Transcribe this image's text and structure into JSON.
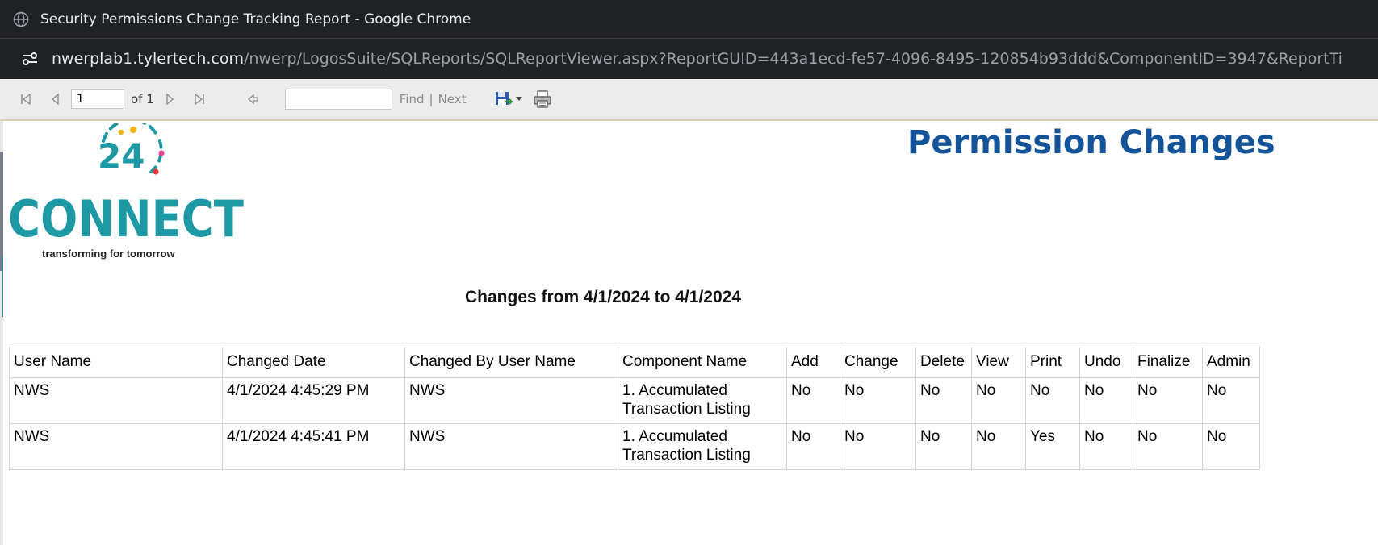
{
  "browser": {
    "window_title": "Security Permissions Change Tracking Report - Google Chrome",
    "url_host": "nwerplab1.tylertech.com",
    "url_path": "/nwerp/LogosSuite/SQLReports/SQLReportViewer.aspx?ReportGUID=443a1ecd-fe57-4096-8495-120854b93ddd&ComponentID=3947&ReportTi"
  },
  "toolbar": {
    "page_value": "1",
    "of_label": "of 1",
    "find_label": "Find",
    "separator": "|",
    "next_label": "Next"
  },
  "logo": {
    "digits": "24",
    "wordmark": "CONNECT",
    "tagline": "transforming for tomorrow"
  },
  "report": {
    "title": "Permission Changes",
    "subtitle": "Changes from 4/1/2024 to 4/1/2024"
  },
  "table": {
    "headers": [
      "User Name",
      "Changed Date",
      "Changed By User Name",
      "Component Name",
      "Add",
      "Change",
      "Delete",
      "View",
      "Print",
      "Undo",
      "Finalize",
      "Admin"
    ],
    "rows": [
      [
        "NWS",
        "4/1/2024 4:45:29 PM",
        "NWS",
        "1. Accumulated Transaction Listing",
        "No",
        "No",
        "No",
        "No",
        "No",
        "No",
        "No",
        "No"
      ],
      [
        "NWS",
        "4/1/2024 4:45:41 PM",
        "NWS",
        "1. Accumulated Transaction Listing",
        "No",
        "No",
        "No",
        "No",
        "Yes",
        "No",
        "No",
        "No"
      ]
    ]
  },
  "colors": {
    "title_blue": "#13539a",
    "logo_teal": "#1d99a6",
    "chrome_dark": "#202124"
  },
  "icons": [
    "globe-icon",
    "site-settings-icon",
    "first-page-icon",
    "previous-page-icon",
    "next-page-icon",
    "last-page-icon",
    "back-to-parent-icon",
    "export-save-icon",
    "dropdown-arrow-icon",
    "print-icon"
  ]
}
